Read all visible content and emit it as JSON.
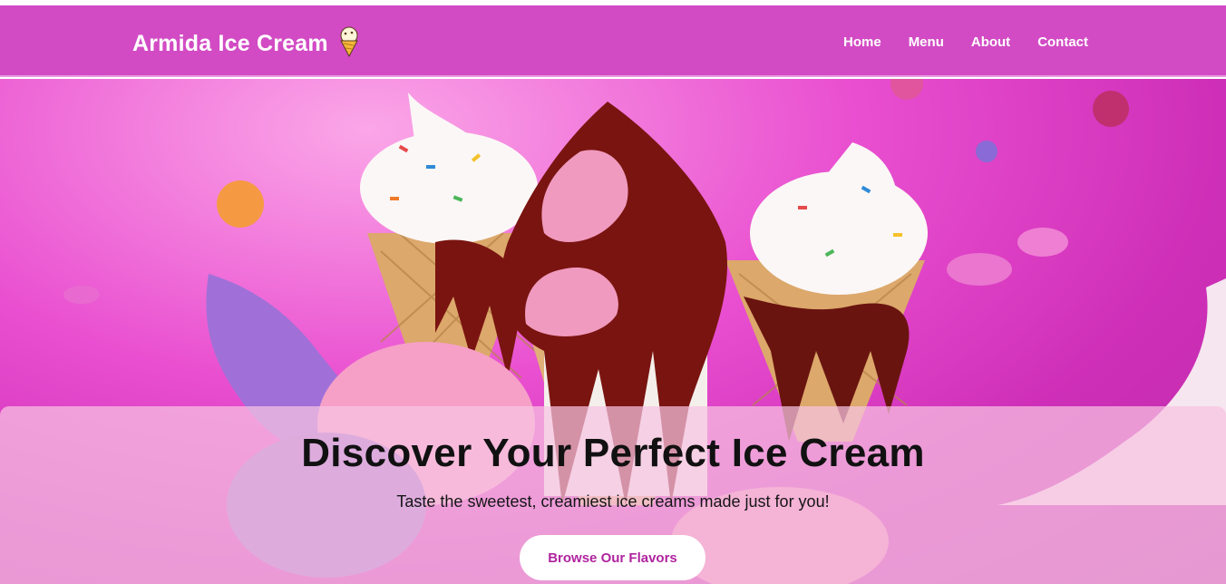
{
  "header": {
    "brand": "Armida Ice Cream",
    "brand_icon": "ice-cream-cone-icon",
    "nav": [
      {
        "label": "Home"
      },
      {
        "label": "Menu"
      },
      {
        "label": "About"
      },
      {
        "label": "Contact"
      }
    ]
  },
  "hero": {
    "image": "ice-cream-cones-splash-image",
    "title": "Discover Your Perfect Ice Cream",
    "subtitle": "Taste the sweetest, creamiest ice creams made just for you!",
    "cta_label": "Browse Our Flavors"
  },
  "colors": {
    "navbar": "#d24bc4",
    "hero_pink": "#e94fd0",
    "cta_text": "#b0249f",
    "panel": "#f6c4e2"
  }
}
